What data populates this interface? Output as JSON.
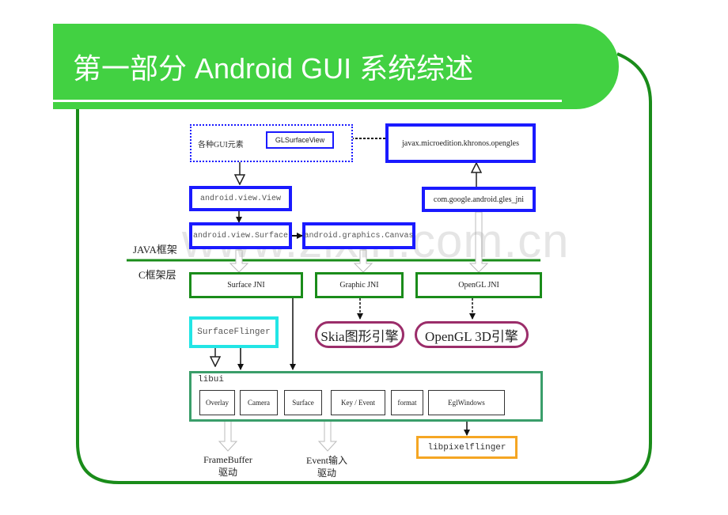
{
  "slide": {
    "title": "第一部分   Android GUI 系统综述",
    "colors": {
      "title_band": "#42d142",
      "frame": "#1a8c1a",
      "java_box": "#1a1aff",
      "jni_box": "#1a8c1a",
      "engine_pill": "#9b2d6a",
      "surfaceflinger": "#22e5e5",
      "libui": "#3a9e6a",
      "libpixelflinger": "#f5a623"
    }
  },
  "diagram": {
    "layers": {
      "java": "JAVA框架",
      "c": "C框架层"
    },
    "gui_group": {
      "label": "各种GUI元素",
      "glsurfaceview": "GLSurfaceView"
    },
    "java_nodes": {
      "opengles": "javax.microedition.khronos.opengles",
      "gles_jni": "com.google.android.gles_jni",
      "view": "android.view.View",
      "surface": "android.view.Surface",
      "canvas": "android.graphics.Canvas"
    },
    "jni_nodes": {
      "surface_jni": "Surface JNI",
      "graphic_jni": "Graphic JNI",
      "opengl_jni": "OpenGL JNI"
    },
    "engines": {
      "skia": "Skia图形引擎",
      "opengl3d": "OpenGL 3D引擎"
    },
    "surfaceflinger": "SurfaceFlinger",
    "libui": {
      "label": "libui",
      "modules": [
        "Overlay",
        "Camera",
        "Surface",
        "Key / Event",
        "format",
        "EglWindows"
      ]
    },
    "libpixelflinger": "libpixelflinger",
    "outputs": {
      "framebuffer_line1": "FrameBuffer",
      "framebuffer_line2": "驱动",
      "event_line1": "Event输入",
      "event_line2": "驱动"
    }
  },
  "watermark": "www.zixin.com.cn"
}
